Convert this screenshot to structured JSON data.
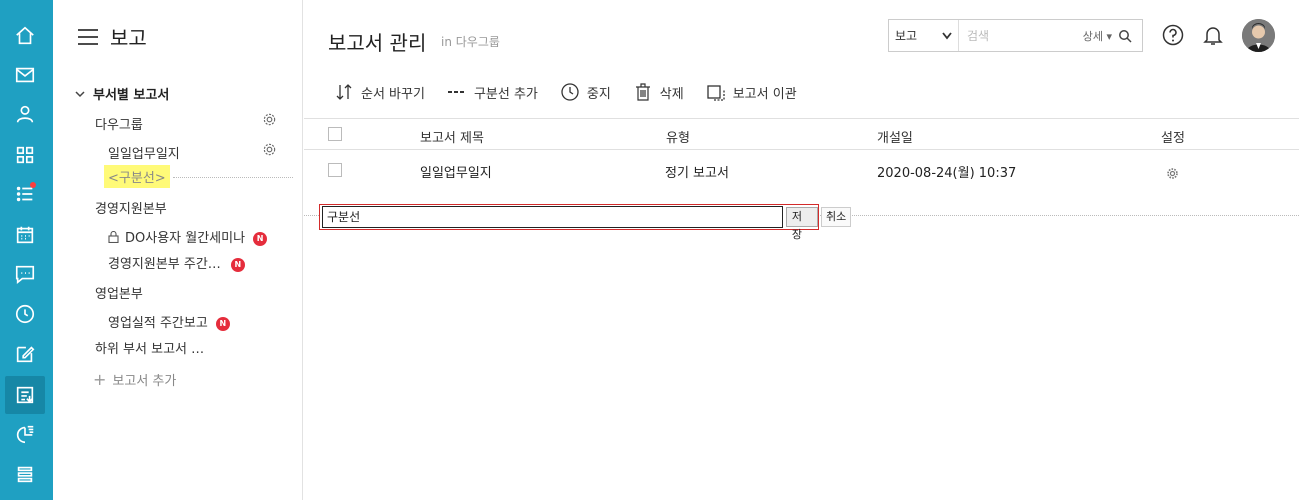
{
  "rail": {
    "items": [
      "home-icon",
      "mail-icon",
      "user-icon",
      "apps-icon",
      "list-icon",
      "calendar-icon",
      "chat-icon",
      "clock-icon",
      "edit-icon",
      "report-icon",
      "chart-icon",
      "menu-icon"
    ],
    "active": "report-icon",
    "accent": "#1fa0c2"
  },
  "sidebar": {
    "title": "보고",
    "group": "부서별 보고서",
    "items": [
      {
        "label": "다우그룹"
      },
      {
        "label": "일일업무일지"
      },
      {
        "label": "<구분선>"
      },
      {
        "label": "경영지원본부"
      },
      {
        "label": "DO사용자 월간세미나",
        "badge": "N"
      },
      {
        "label": "경영지원본부 주간…",
        "badge": "N"
      },
      {
        "label": "영업본부"
      },
      {
        "label": "영업실적 주간보고",
        "badge": "N"
      },
      {
        "label": "하위 부서 보고서 …"
      }
    ],
    "add_label": "보고서 추가"
  },
  "header": {
    "title": "보고서 관리",
    "subtitle": "in 다우그룹",
    "search": {
      "select_value": "보고",
      "placeholder": "검색",
      "detail_label": "상세"
    }
  },
  "toolbar": {
    "reorder": "순서 바꾸기",
    "add_separator": "구분선 추가",
    "stop": "중지",
    "delete": "삭제",
    "transfer": "보고서 이관"
  },
  "table": {
    "columns": [
      "보고서 제목",
      "유형",
      "개설일",
      "설정"
    ],
    "rows": [
      {
        "title": "일일업무일지",
        "type": "정기 보고서",
        "created": "2020-08-24(월) 10:37"
      }
    ]
  },
  "separator_editor": {
    "value": "구분선",
    "save_label": "저장",
    "cancel_label": "취소"
  }
}
